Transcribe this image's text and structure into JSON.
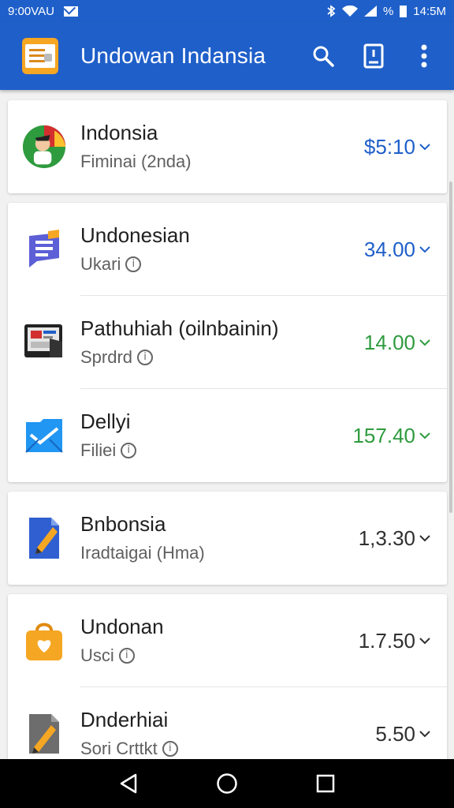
{
  "status_bar": {
    "left_text": "9:00VAU",
    "time": "14:5M",
    "battery": "%"
  },
  "app_bar": {
    "title": "Undowan Indansia"
  },
  "cards": [
    {
      "rows": [
        {
          "title": "Indonsia",
          "subtitle": "Fiminai (2nda)",
          "amount": "$5:10",
          "amount_color": "#1f5fc9",
          "icon": "flag-avatar-icon",
          "show_info": false
        }
      ]
    },
    {
      "rows": [
        {
          "title": "Undonesian",
          "subtitle": "Ukari",
          "amount": "34.00",
          "amount_color": "#1f5fc9",
          "icon": "chat-doc-icon",
          "show_info": true
        },
        {
          "title": "Pathuhiah (oilnbainin)",
          "subtitle": "Sprdrd",
          "amount": "14.00",
          "amount_color": "#2e9b3e",
          "icon": "laptop-icon",
          "show_info": true
        },
        {
          "title": "Dellyi",
          "subtitle": "Filiei",
          "amount": "157.40",
          "amount_color": "#2e9b3e",
          "icon": "email-icon",
          "show_info": true
        }
      ]
    },
    {
      "rows": [
        {
          "title": "Bnbonsia",
          "subtitle": "Iradtaigai (Hma)",
          "amount": "1,3.30",
          "amount_color": "#303030",
          "icon": "document-pen-icon",
          "show_info": false
        }
      ]
    },
    {
      "rows": [
        {
          "title": "Undonan",
          "subtitle": "Usci",
          "amount": "1.7.50",
          "amount_color": "#303030",
          "icon": "shopping-bag-icon",
          "show_info": true
        },
        {
          "title": "Dnderhiai",
          "subtitle": "Sori Crttkt",
          "amount": "5.50",
          "amount_color": "#303030",
          "icon": "pencil-note-icon",
          "show_info": true
        }
      ]
    }
  ],
  "colors": {
    "primary": "#1f5fc9",
    "positive": "#2e9b3e",
    "neutral": "#303030"
  }
}
